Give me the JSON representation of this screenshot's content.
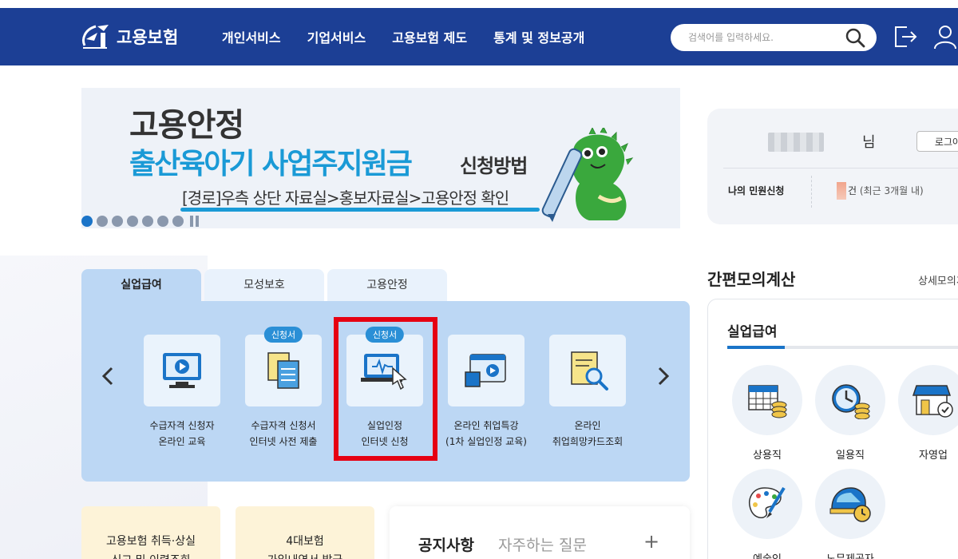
{
  "header": {
    "logo_text": "고용보험",
    "nav": [
      "개인서비스",
      "기업서비스",
      "고용보험 제도",
      "통계 및 정보공개"
    ],
    "search_placeholder": "검색어를 입력하세요."
  },
  "banner": {
    "title": "고용안정",
    "subtitle": "출산육아기 사업주지원금",
    "subtitle_small": "신청방법",
    "path": "[경로]우측 상단 자료실>홍보자료실>고용안정 확인",
    "slide_count": 7,
    "active_slide": 1
  },
  "login": {
    "suffix": "님",
    "button": "로그아웃",
    "my_label": "나의 민원신청",
    "count_text": "건",
    "count_note": "(최근 3개월 내)"
  },
  "tabs": [
    "실업급여",
    "모성보호",
    "고용안정"
  ],
  "services": [
    {
      "line1": "수급자격 신청자",
      "line2": "온라인 교육",
      "badge": ""
    },
    {
      "line1": "수급자격 신청서",
      "line2": "인터넷 사전 제출",
      "badge": "신청서"
    },
    {
      "line1": "실업인정",
      "line2": "인터넷 신청",
      "badge": "신청서"
    },
    {
      "line1": "온라인 취업특강",
      "line2": "(1차 실업인정 교육)",
      "badge": ""
    },
    {
      "line1": "온라인",
      "line2": "취업희망카드조회",
      "badge": ""
    }
  ],
  "bottom_cards": [
    {
      "line1": "고용보험 취득·상실",
      "line2": "신고 및 이력조회"
    },
    {
      "line1": "4대보험",
      "line2": "가입내역서 발급"
    }
  ],
  "notice": {
    "tabs": [
      "공지사항",
      "자주하는 질문"
    ],
    "plus": "+"
  },
  "calc": {
    "title": "간편모의계산",
    "more": "상세모의계산",
    "tab": "실업급여",
    "items": [
      "상용직",
      "일용직",
      "자영업",
      "예술인",
      "노무제공자"
    ]
  },
  "colors": {
    "header": "#1c3f95",
    "accent": "#1a9ad6",
    "panel": "#bcd7f4",
    "highlight": "#e60012"
  }
}
